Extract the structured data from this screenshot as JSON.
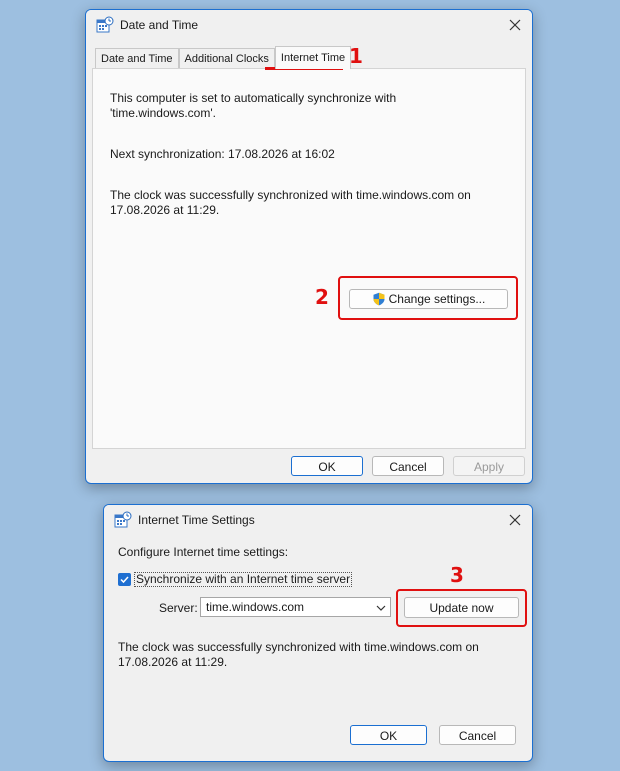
{
  "main_window": {
    "title": "Date and Time",
    "tabs": [
      {
        "label": "Date and Time"
      },
      {
        "label": "Additional Clocks"
      },
      {
        "label": "Internet Time"
      }
    ],
    "sync_line1": "This computer is set to automatically synchronize with",
    "sync_line2": "'time.windows.com'.",
    "next_sync": "Next synchronization: 17.08.2026 at 16:02",
    "success_line1": "The clock was successfully synchronized with time.windows.com on",
    "success_line2": "17.08.2026 at 11:29.",
    "change_settings_label": "Change settings...",
    "ok_label": "OK",
    "cancel_label": "Cancel",
    "apply_label": "Apply"
  },
  "settings_window": {
    "title": "Internet Time Settings",
    "configure_label": "Configure Internet time settings:",
    "sync_checkbox_label": "Synchronize with an Internet time server",
    "sync_checked": true,
    "server_label": "Server:",
    "server_value": "time.windows.com",
    "update_now_label": "Update now",
    "success_line1": "The clock was successfully synchronized with time.windows.com on",
    "success_line2": "17.08.2026 at 11:29.",
    "ok_label": "OK",
    "cancel_label": "Cancel"
  },
  "annotations": {
    "step1": "1",
    "step2": "2",
    "step3": "3",
    "highlight_color": "#e01010"
  },
  "icons": {
    "app_icon": "date-time-app-icon",
    "close_icon": "close-icon",
    "shield_icon": "uac-shield-icon",
    "dropdown_icon": "chevron-down-icon",
    "check_icon": "checkmark-icon"
  }
}
